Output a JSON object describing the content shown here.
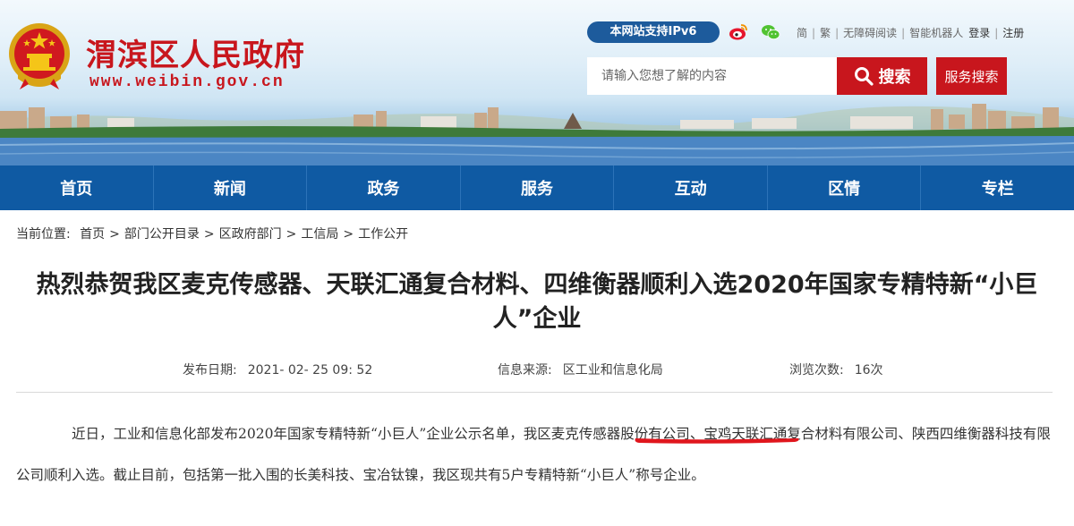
{
  "header": {
    "site_title": "渭滨区人民政府",
    "site_url": "www.weibin.gov.cn",
    "ipv6_badge": "本网站支持IPv6",
    "top_links": [
      "简",
      "繁",
      "无障碍阅读",
      "智能机器人"
    ],
    "login": "登录",
    "register": "注册",
    "search": {
      "placeholder": "请输入您想了解的内容",
      "button_label": "搜索",
      "service_search_label": "服务搜索"
    },
    "icons": [
      "weibo-icon",
      "wechat-icon",
      "search-icon",
      "emblem"
    ],
    "brand_color": "#c8161d",
    "nav_color": "#0f5aa3"
  },
  "nav": {
    "items": [
      "首页",
      "新闻",
      "政务",
      "服务",
      "互动",
      "区情",
      "专栏"
    ]
  },
  "breadcrumb": {
    "prefix": "当前位置:",
    "items": [
      "首页",
      "部门公开目录",
      "区政府部门",
      "工信局",
      "工作公开"
    ],
    "separators": [
      ">",
      ">",
      ">",
      ">"
    ]
  },
  "article": {
    "title": "热烈恭贺我区麦克传感器、天联汇通复合材料、四维衡器顺利入选2020年国家专精特新“小巨人”企业",
    "meta": {
      "publish_label": "发布日期:",
      "publish_value": "2021- 02- 25 09: 52",
      "source_label": "信息来源:",
      "source_value": "区工业和信息化局",
      "views_label": "浏览次数:",
      "views_value": "16次"
    },
    "body": {
      "part1": "近日，工业和信息化部发布2020年国家专精特新“小巨人”企业公示名单，我区",
      "highlight": "麦克传感器股份有公司",
      "part2": "、宝鸡天联汇通复合材料有限公司、陕西四维衡器科技有限公司顺利入选。截止目前，包括第一批入围的长美科技、宝冶钛镍，我区现共有5户专精特新“小巨人”称号企业。"
    }
  }
}
